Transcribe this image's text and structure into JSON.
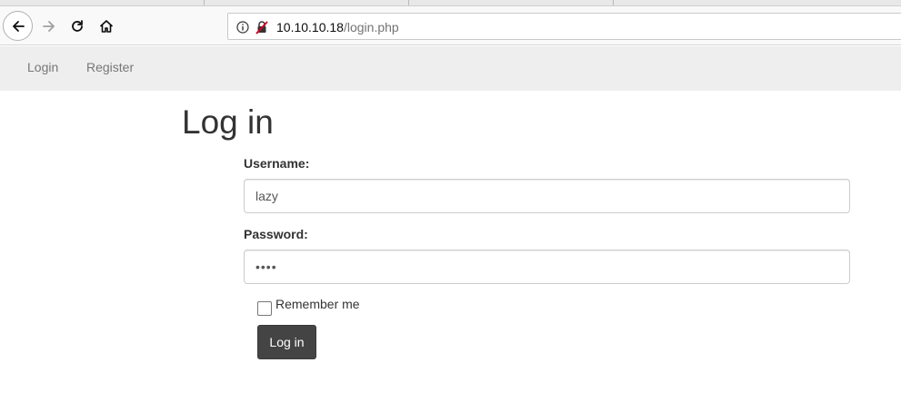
{
  "browser": {
    "url_host": "10.10.10.18",
    "url_path": "/login.php"
  },
  "site_nav": {
    "items": [
      {
        "label": "Login"
      },
      {
        "label": "Register"
      }
    ]
  },
  "main": {
    "title": "Log in",
    "username_label": "Username:",
    "username_value": "lazy",
    "password_label": "Password:",
    "password_value": "••••",
    "remember_label": "Remember me",
    "remember_checked": false,
    "submit_label": "Log in"
  }
}
